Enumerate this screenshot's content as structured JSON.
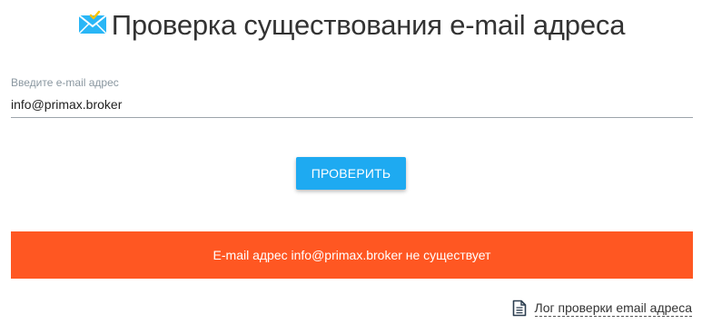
{
  "header": {
    "title": "Проверка существования e-mail адреса",
    "icon": "envelope-check-icon"
  },
  "form": {
    "email_label": "Введите e-mail адрес",
    "email_value": "info@primax.broker",
    "submit_label": "ПРОВЕРИТЬ"
  },
  "result": {
    "message": "E-mail адрес info@primax.broker не существует",
    "color": "#ff5722"
  },
  "footer": {
    "log_link_label": "Лог проверки email адреса",
    "log_icon": "document-icon"
  },
  "colors": {
    "accent": "#1eaaf1",
    "error": "#ff5722",
    "text": "#333333"
  }
}
